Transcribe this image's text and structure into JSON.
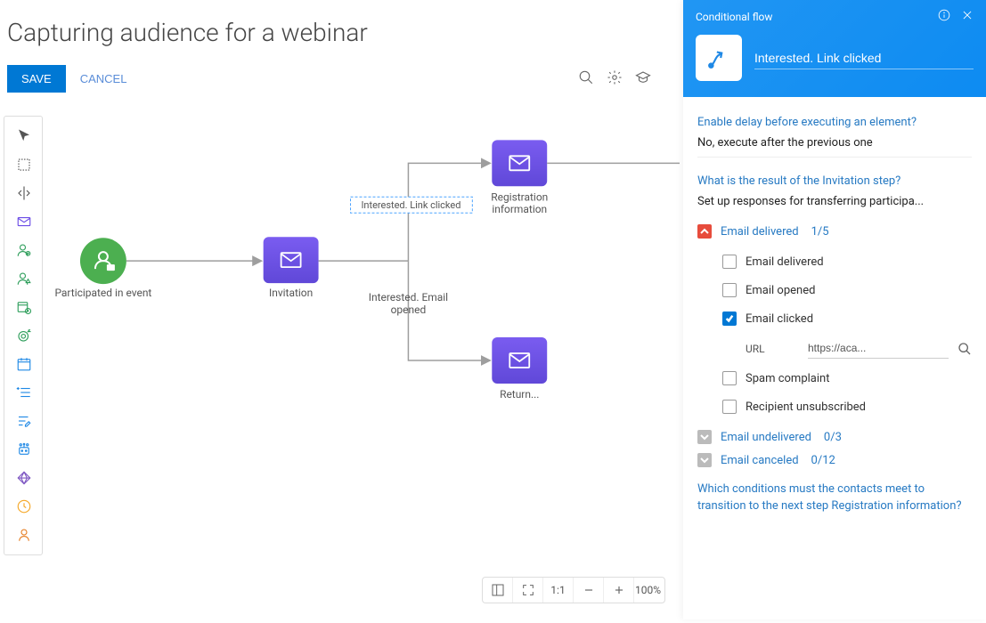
{
  "header": {
    "title": "Capturing audience for a webinar",
    "save_label": "SAVE",
    "cancel_label": "CANCEL"
  },
  "zoom": {
    "ratio": "1:1",
    "percent": "100%"
  },
  "canvas": {
    "nodes": {
      "event": {
        "label": "Participated in event"
      },
      "invitation": {
        "label": "Invitation"
      },
      "branch_chip": "Interested. Link clicked",
      "branch_label_top": "Interested. Email",
      "branch_label_bottom": "opened",
      "reg_top": "Registration",
      "reg_bottom": "information",
      "return": {
        "label": "Return..."
      }
    }
  },
  "panel": {
    "header_type": "Conditional flow",
    "title": "Interested. Link clicked",
    "q_delay": "Enable delay before executing an element?",
    "a_delay": "No, execute after the previous one",
    "q_result": "What is the result of the Invitation step?",
    "a_result": "Set up responses for transferring participa...",
    "groups": [
      {
        "title": "Email delivered",
        "count": "1/5",
        "open": true
      },
      {
        "title": "Email undelivered",
        "count": "0/3",
        "open": false
      },
      {
        "title": "Email canceled",
        "count": "0/12",
        "open": false
      }
    ],
    "options": [
      {
        "label": "Email delivered",
        "checked": false
      },
      {
        "label": "Email opened",
        "checked": false
      },
      {
        "label": "Email clicked",
        "checked": true
      },
      {
        "label": "Spam complaint",
        "checked": false
      },
      {
        "label": "Recipient unsubscribed",
        "checked": false
      }
    ],
    "url_label": "URL",
    "url_value": "https://aca...",
    "q_conditions": "Which conditions must the contacts meet to transition to the next step Registration information?"
  }
}
